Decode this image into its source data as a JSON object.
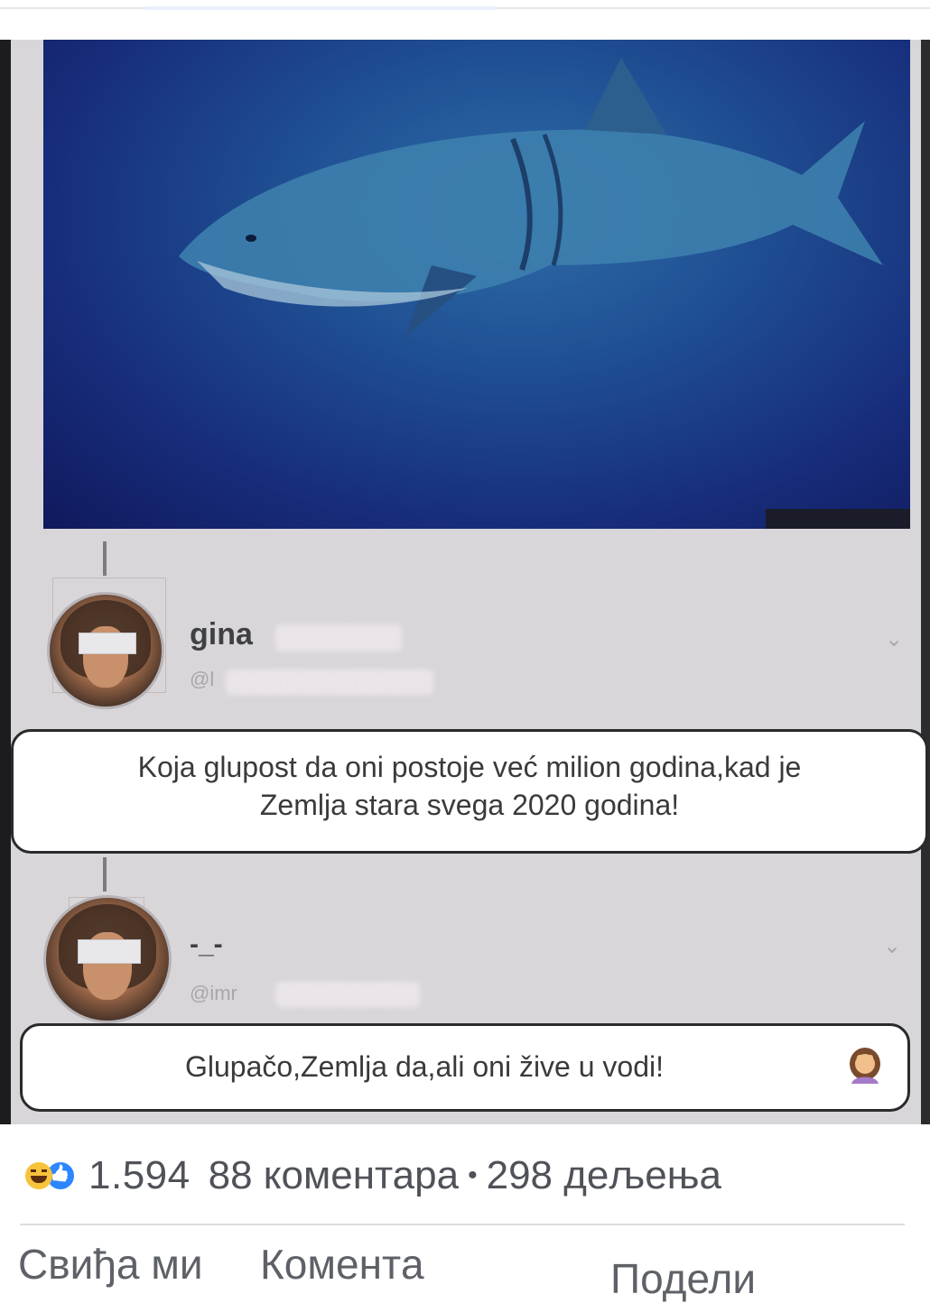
{
  "post": {
    "comment1": {
      "username": "gina",
      "handle": "@l",
      "text_line1": "Koja glupost da oni postoje već milion godina,kad je",
      "text_line2": "Zemlja stara svega 2020 godina!"
    },
    "comment2": {
      "username": "-_-",
      "handle": "@imr",
      "text": "Glupačo,Zemlja da,ali oni žive u vodi!"
    }
  },
  "stats": {
    "reactions": [
      "haha-icon",
      "like-icon"
    ],
    "reaction_count": "1.594",
    "comments": "88 коментара",
    "separator": "•",
    "shares": "298 дељења"
  },
  "actions": {
    "like": "Свиђа ми",
    "comment": "Коментa",
    "share": "Подели"
  },
  "colors": {
    "text": "#4f5258",
    "bubble_border": "#2a2a2c",
    "water": "#172d7b"
  }
}
